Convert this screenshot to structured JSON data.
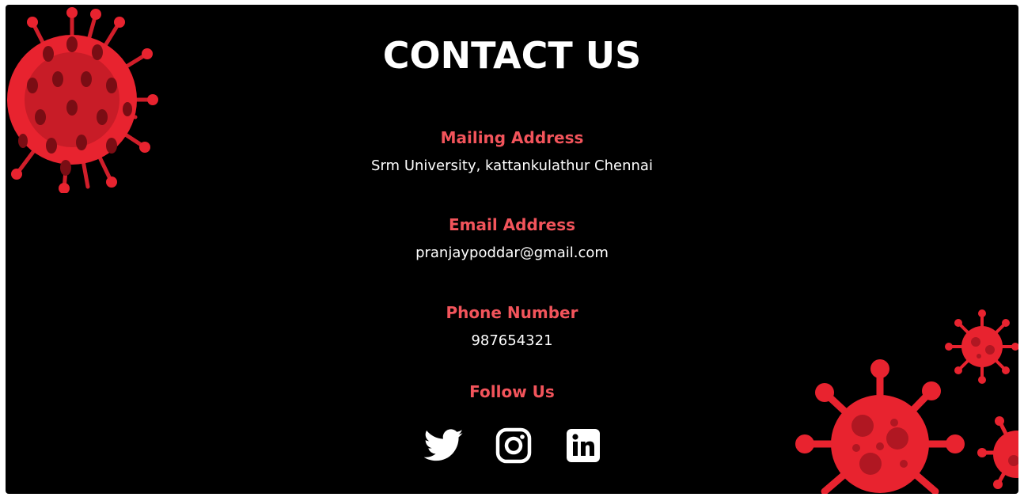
{
  "page": {
    "title": "CONTACT US"
  },
  "sections": [
    {
      "heading": "Mailing Address",
      "value": "Srm University, kattankulathur Chennai"
    },
    {
      "heading": "Email Address",
      "value": "pranjaypoddar@gmail.com"
    },
    {
      "heading": "Phone Number",
      "value": "987654321"
    }
  ],
  "follow": {
    "heading": "Follow Us",
    "icons": [
      "twitter-icon",
      "instagram-icon",
      "linkedin-icon"
    ]
  },
  "colors": {
    "background": "#000000",
    "accent": "#f2545b",
    "text": "#ffffff",
    "virus_red": "#e8232f",
    "virus_dark": "#b01722"
  }
}
